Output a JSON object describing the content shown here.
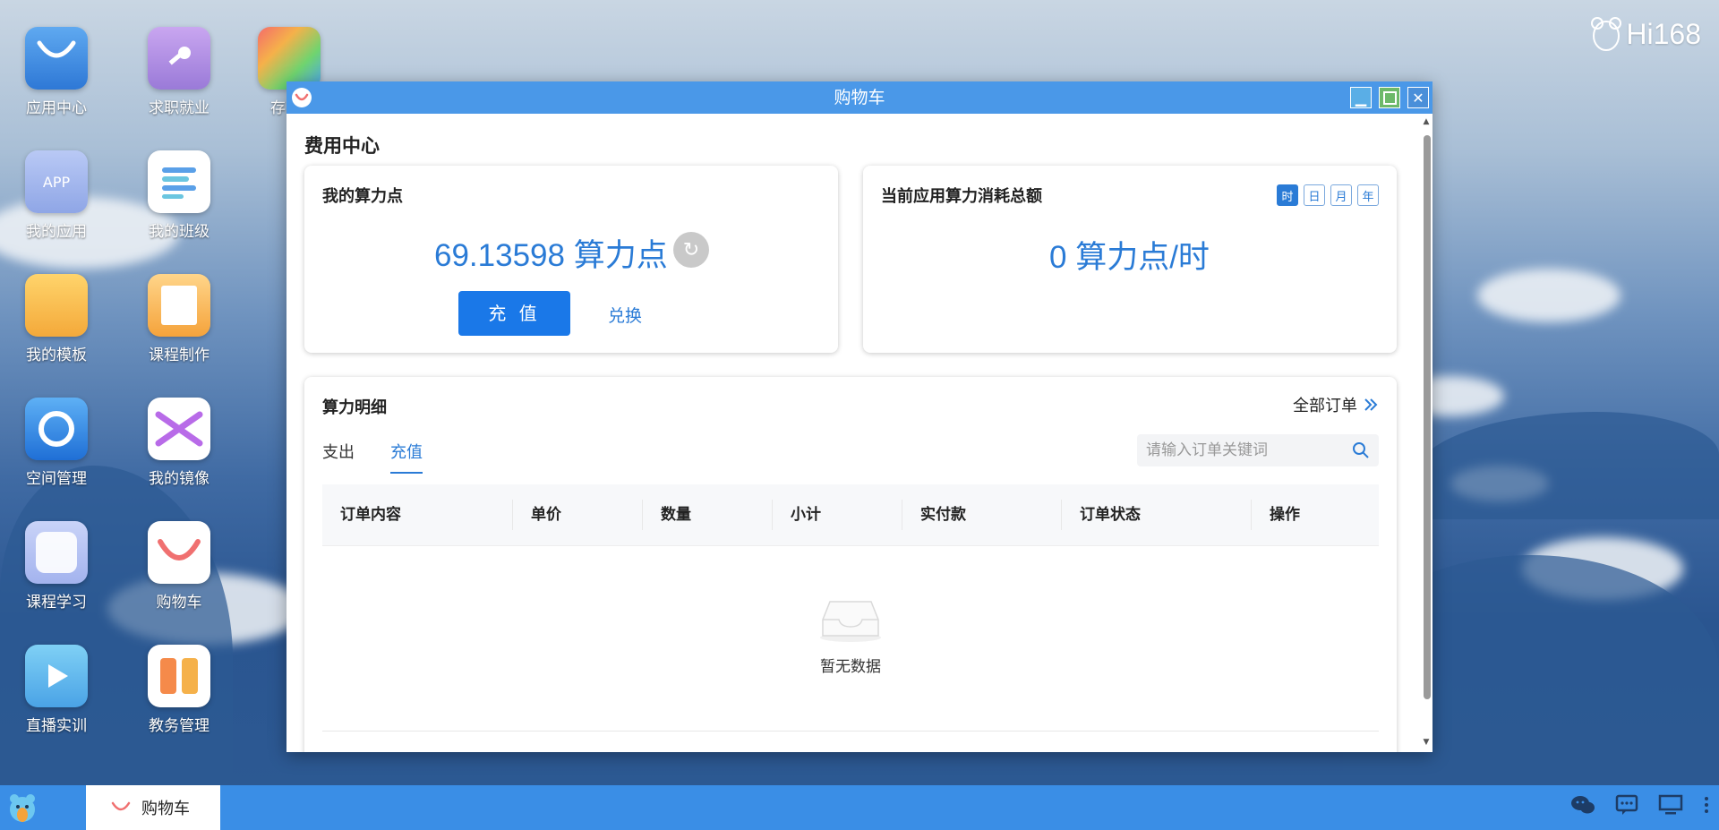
{
  "brand": {
    "name": "Hi168"
  },
  "desktop_icons": [
    {
      "label": "应用中心",
      "icon": "shopping-bag-icon"
    },
    {
      "label": "求职就业",
      "icon": "key-icon"
    },
    {
      "label": "存",
      "icon": "paint-bucket-icon"
    },
    {
      "label": "我的应用",
      "icon": "app-icon",
      "badge": "APP"
    },
    {
      "label": "我的班级",
      "icon": "list-icon"
    },
    {
      "label": "我的模板",
      "icon": "folder-icon"
    },
    {
      "label": "课程制作",
      "icon": "notebook-icon"
    },
    {
      "label": "空间管理",
      "icon": "ring-icon"
    },
    {
      "label": "我的镜像",
      "icon": "ribbon-icon"
    },
    {
      "label": "课程学习",
      "icon": "blank-icon"
    },
    {
      "label": "购物车",
      "icon": "cart-smile-icon"
    },
    {
      "label": "直播实训",
      "icon": "play-icon"
    },
    {
      "label": "教务管理",
      "icon": "columns-icon"
    }
  ],
  "window": {
    "title": "购物车",
    "section_title": "费用中心",
    "balance_card": {
      "title": "我的算力点",
      "value": "69.13598 算力点",
      "recharge_label": "充 值",
      "exchange_label": "兑换"
    },
    "consumption_card": {
      "title": "当前应用算力消耗总额",
      "value": "0 算力点/时",
      "periods": [
        "时",
        "日",
        "月",
        "年"
      ],
      "active_period": "时"
    },
    "detail": {
      "title": "算力明细",
      "all_orders_label": "全部订单",
      "tabs": [
        "支出",
        "充值"
      ],
      "active_tab": "充值",
      "search_placeholder": "请输入订单关键词",
      "columns": [
        "订单内容",
        "单价",
        "数量",
        "小计",
        "实付款",
        "订单状态",
        "操作"
      ],
      "empty_text": "暂无数据"
    }
  },
  "taskbar": {
    "active_item": "购物车"
  },
  "colors": {
    "accent": "#2a7bd6",
    "titlebar": "#4a98e8",
    "taskbar": "#3a8ee6"
  }
}
